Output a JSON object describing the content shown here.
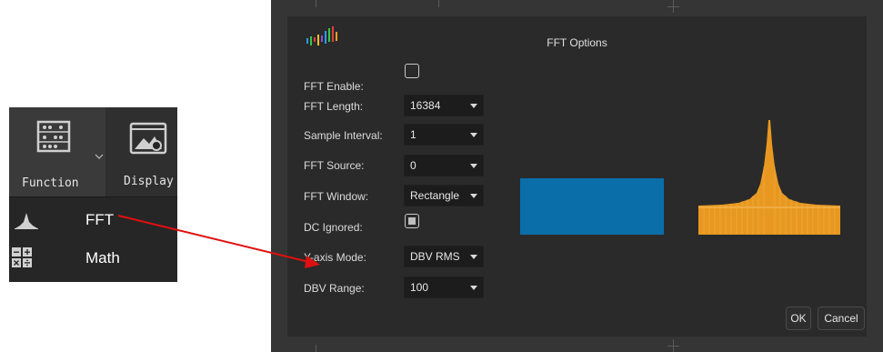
{
  "toolbar": {
    "function_label": "Function",
    "display_label": "Display",
    "menu": [
      {
        "label": "FFT",
        "icon": "spectrum-icon"
      },
      {
        "label": "Math",
        "icon": "calculator-icon"
      }
    ]
  },
  "dialog": {
    "title": "FFT Options",
    "fields": {
      "fft_enable": {
        "label": "FFT Enable:",
        "checked": false
      },
      "fft_length": {
        "label": "FFT Length:",
        "value": "16384"
      },
      "sample_interval": {
        "label": "Sample Interval:",
        "value": "1"
      },
      "fft_source": {
        "label": "FFT Source:",
        "value": "0"
      },
      "fft_window": {
        "label": "FFT Window:",
        "value": "Rectangle"
      },
      "dc_ignored": {
        "label": "DC Ignored:",
        "checked": true
      },
      "y_axis_mode": {
        "label": "Y-axis Mode:",
        "value": "DBV RMS"
      },
      "dbv_range": {
        "label": "DBV Range:",
        "value": "100"
      }
    },
    "ok_label": "OK",
    "cancel_label": "Cancel"
  },
  "colors": {
    "window_shape": "#0a6fa8",
    "spectrum": "#f0a020",
    "annotation_arrow": "#e01010"
  }
}
